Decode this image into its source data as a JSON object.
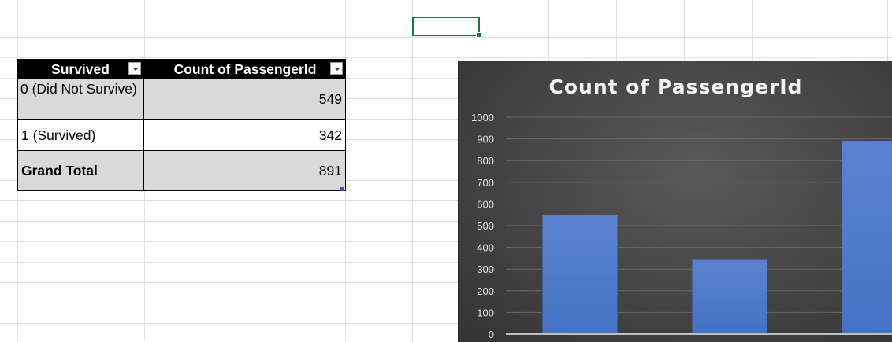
{
  "pivot_table": {
    "header": {
      "col1": "Survived",
      "col2": "Count of PassengerId"
    },
    "rows": [
      {
        "label": "0 (Did Not Survive)",
        "value": "549"
      },
      {
        "label": "1 (Survived)",
        "value": "342"
      },
      {
        "label": "Grand Total",
        "value": "891"
      }
    ]
  },
  "chart_data": {
    "type": "bar",
    "title": "Count of PassengerId",
    "categories": [
      "0 (Did Not Survive)",
      "1 (Survived)",
      "Grand Total"
    ],
    "values": [
      549,
      342,
      891
    ],
    "ylim": [
      0,
      1000
    ],
    "yticks": [
      "0",
      "100",
      "200",
      "300",
      "400",
      "500",
      "600",
      "700",
      "800",
      "900",
      "1000"
    ],
    "grid": true,
    "bar_color": "#4472c4",
    "background_color": "#404040"
  }
}
